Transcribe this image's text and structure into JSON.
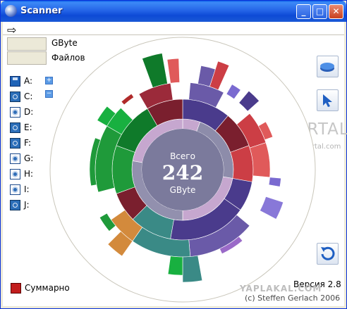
{
  "window": {
    "title": "Scanner"
  },
  "toolbar": {
    "nav_arrow": "⇨"
  },
  "fields": {
    "size_label": "GByte",
    "files_label": "Файлов",
    "size_value": "",
    "files_value": ""
  },
  "drives": [
    {
      "label": "A:",
      "type": "floppy"
    },
    {
      "label": "C:",
      "type": "hdd"
    },
    {
      "label": "D:",
      "type": "cd"
    },
    {
      "label": "E:",
      "type": "hdd"
    },
    {
      "label": "F:",
      "type": "hdd"
    },
    {
      "label": "G:",
      "type": "cd"
    },
    {
      "label": "H:",
      "type": "cd"
    },
    {
      "label": "I:",
      "type": "cd"
    },
    {
      "label": "J:",
      "type": "hdd"
    }
  ],
  "center": {
    "label_top": "Всего",
    "value": "242",
    "unit": "GByte"
  },
  "summary_label": "Суммарно",
  "version": "Версия 2.8",
  "copyright": "(c) Steffen Gerlach 2006",
  "watermarks": {
    "softportal": "SOFTPORTAL",
    "softportal_url": "www.softportal.com",
    "yaplakal": "YAPLAKAL.COM"
  },
  "icons": {
    "toolbar": "arrow-right-icon",
    "side_buttons": [
      "disk-icon",
      "cursor-icon",
      "refresh-icon"
    ],
    "expand": "plus-icon",
    "collapse": "minus-icon"
  },
  "colors": {
    "title_bar": "#2566e8",
    "center_disk": "#7b7a9c",
    "inner_ring": "#c6a7cf",
    "green": "#1f9a3a",
    "red": "#cc3e45",
    "purple": "#4a3b8c",
    "teal": "#3a8a86",
    "orange": "#d38a3c"
  }
}
